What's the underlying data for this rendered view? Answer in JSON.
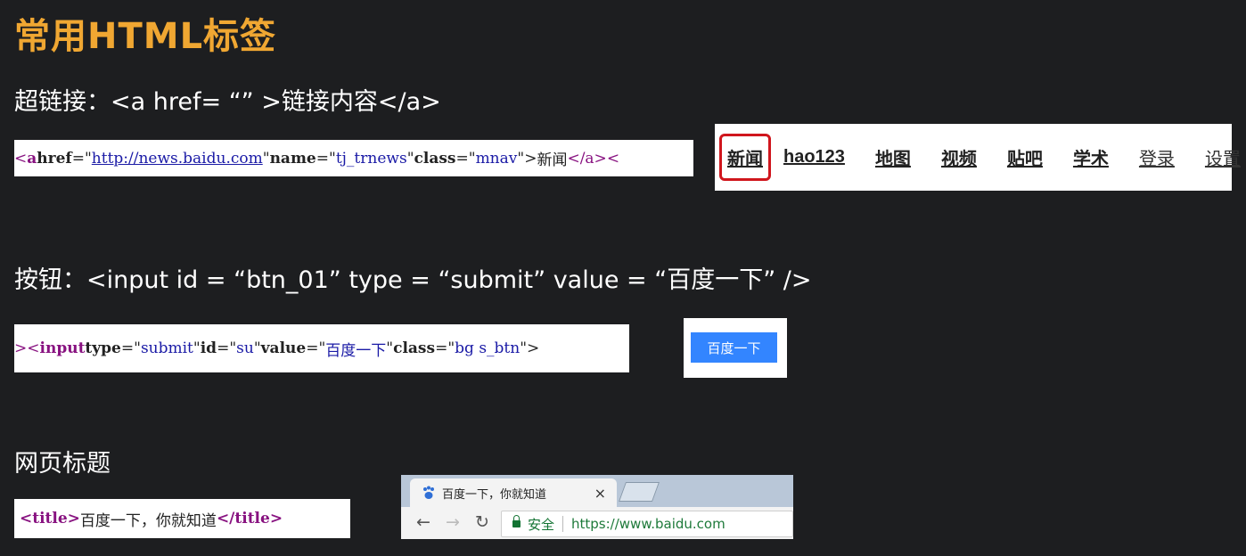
{
  "slide": {
    "title": "常用HTML标签",
    "hyperlink_heading": "超链接：<a href= “” >链接内容</a>",
    "button_heading": "按钮：<input id = “btn_01” type = “submit” value = “百度一下” />",
    "title_heading": "网页标题"
  },
  "code_link": {
    "lead": "<",
    "tag": "a",
    "attr1": " href",
    "eq1": "=\"",
    "val1": "http://news.baidu.com",
    "q1": "\"",
    "attr2": " name",
    "eq2": "=\"",
    "val2": "tj_trnews",
    "q2": "\"",
    "attr3": " class",
    "eq3": "=\"",
    "val3": "mnav",
    "q3": "\">",
    "text": "新闻",
    "close": "</a>",
    "trail": "<"
  },
  "navbar": {
    "items": [
      "新闻",
      "hao123",
      "地图",
      "视频",
      "贴吧",
      "学术",
      "登录",
      "设置"
    ]
  },
  "code_input": {
    "lead": "><",
    "tag": "input",
    "attr1": " type",
    "eq1": "=\"",
    "val1": "submit",
    "q1": "\"",
    "attr2": " id",
    "eq2": "=\"",
    "val2": "su",
    "q2": "\"",
    "attr3": " value",
    "eq3": "=\"",
    "val3": "百度一下",
    "q3": "\"",
    "attr4": " class",
    "eq4": "=\"",
    "val4": "bg s_btn",
    "q4": "\">"
  },
  "baidu_button": {
    "label": "百度一下"
  },
  "code_title": {
    "open": "<title>",
    "text": "百度一下，你就知道",
    "close": "</title>"
  },
  "browser": {
    "tab_title": "百度一下，你就知道",
    "tab_close": "×",
    "secure_label": "安全",
    "url": "https://www.baidu.com",
    "icons": [
      "paw-favicon-icon",
      "close-icon",
      "back-arrow-icon",
      "forward-arrow-icon",
      "reload-icon",
      "lock-icon"
    ]
  },
  "colors": {
    "title": "#f0a732",
    "background": "#1d1e20",
    "highlight_border": "#d0161d",
    "baidu_button": "#3385ff",
    "secure_green": "#137333"
  }
}
